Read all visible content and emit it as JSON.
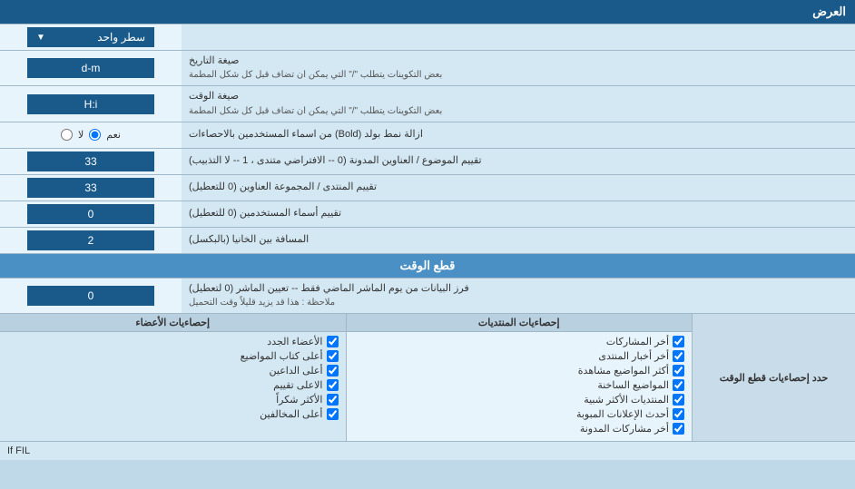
{
  "header": {
    "title": "العرض"
  },
  "rows": [
    {
      "id": "single-line",
      "right_label": "سطر واحد",
      "input_type": "dropdown",
      "input_value": "سطر واحد"
    },
    {
      "id": "date-format",
      "right_label": "صيغة التاريخ",
      "right_sub": "بعض التكوينات يتطلب \"/\" التي يمكن ان تضاف قبل كل شكل المطمة",
      "input_type": "text",
      "input_value": "d-m"
    },
    {
      "id": "time-format",
      "right_label": "صيغة الوقت",
      "right_sub": "بعض التكوينات يتطلب \"/\" التي يمكن ان تضاف قبل كل شكل المطمة",
      "input_type": "text",
      "input_value": "H:i"
    },
    {
      "id": "bold-remove",
      "right_label": "ازالة نمط بولد (Bold) من اسماء المستخدمين بالاحصاءات",
      "input_type": "radio",
      "radio_yes": "نعم",
      "radio_no": "لا",
      "selected": "yes"
    },
    {
      "id": "topics-sort",
      "right_label": "تقييم الموضوع / العناوين المدونة (0 -- الافتراضي متندى ، 1 -- لا التذبيب)",
      "input_type": "text",
      "input_value": "33"
    },
    {
      "id": "forum-sort",
      "right_label": "تقييم المنتدى / المجموعة العناوين (0 للتعطيل)",
      "input_type": "text",
      "input_value": "33"
    },
    {
      "id": "users-sort",
      "right_label": "تقييم أسماء المستخدمين (0 للتعطيل)",
      "input_type": "text",
      "input_value": "0"
    },
    {
      "id": "space-between",
      "right_label": "المسافة بين الخانيا (بالبكسل)",
      "input_type": "text",
      "input_value": "2"
    }
  ],
  "section_cutoff": {
    "title": "قطع الوقت",
    "row_label": "فرز البيانات من يوم الماشر الماضي فقط -- تعيين الماشر (0 لتعطيل)",
    "row_note": "ملاحظة : هذا قد يزيد قليلاً وقت التحميل",
    "input_value": "0"
  },
  "checkboxes": {
    "header_left": "حدد إحصاءيات قطع الوقت",
    "col1_header": "إحصاءيات المنتديات",
    "col2_header": "إحصاءيات الأعضاء",
    "col1_items": [
      "أخر المشاركات",
      "أخر أخبار المنتدى",
      "أكثر المواضيع مشاهدة",
      "المواضيع الساخنة",
      "المنتديات الأكثر شبية",
      "أحدث الإعلانات المبوبة",
      "أخر مشاركات المدونة"
    ],
    "col2_items": [
      "الأعضاء الجدد",
      "أعلى كتاب المواضيع",
      "أعلى الداعين",
      "الاعلى تقييم",
      "الأكثر شكراً",
      "أعلى المخالفين"
    ]
  },
  "bottom_text": "If FIL"
}
